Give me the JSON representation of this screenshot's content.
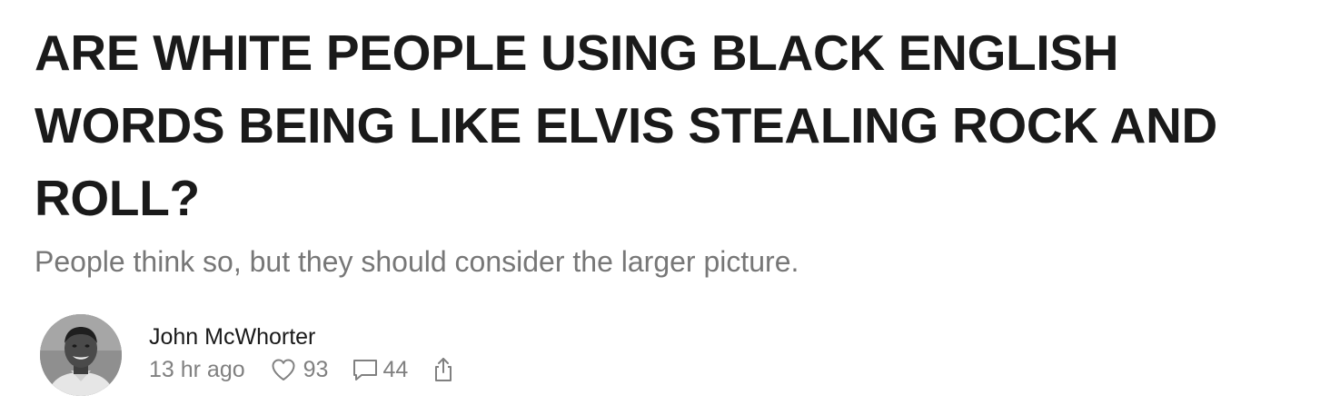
{
  "post": {
    "title_lines": [
      "ARE WHITE PEOPLE USING BLACK ENGLISH",
      "WORDS BEING LIKE ELVIS STEALING ROCK AND",
      "ROLL?"
    ],
    "subtitle": "People think so, but they should consider the larger picture."
  },
  "byline": {
    "author": "John McWhorter",
    "timestamp": "13 hr ago",
    "likes": "93",
    "comments": "44",
    "avatar_icon": "author-avatar",
    "like_icon": "heart-icon",
    "comment_icon": "comment-bubble-icon",
    "share_icon": "share-icon"
  },
  "colors": {
    "title": "#1a1a1a",
    "subtitle": "#777777",
    "meta": "#808080",
    "background": "#ffffff"
  }
}
